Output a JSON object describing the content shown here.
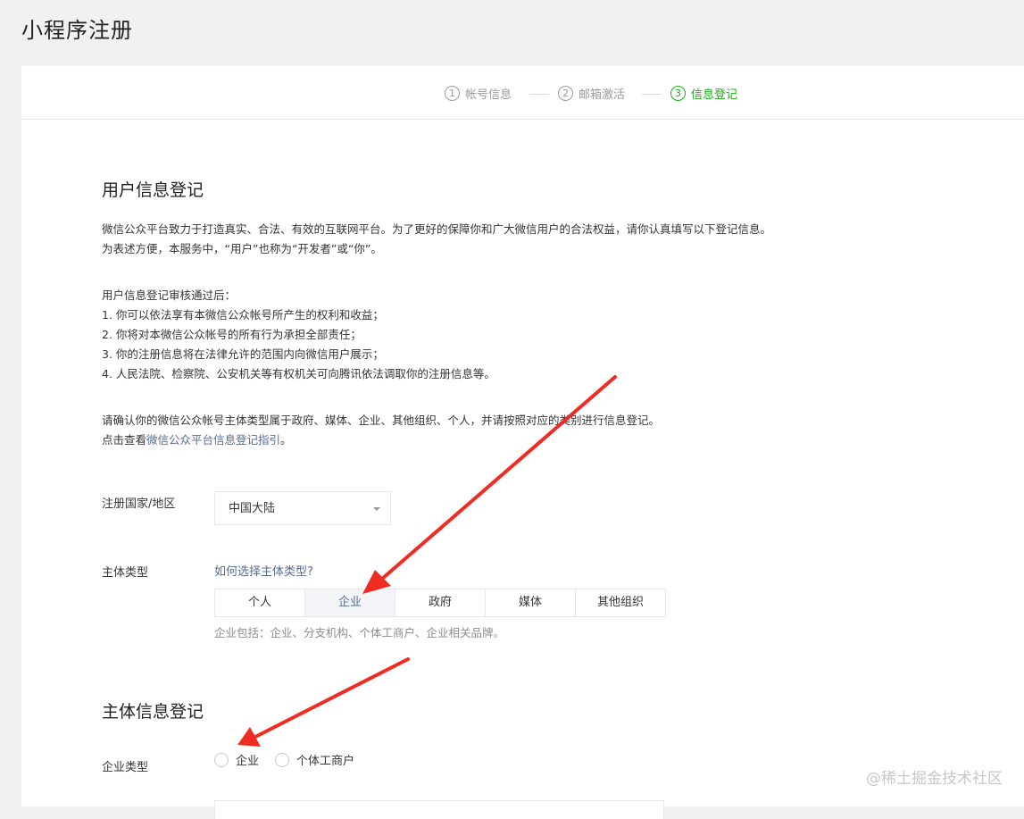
{
  "page": {
    "title": "小程序注册"
  },
  "steps": [
    {
      "num": "1",
      "label": "帐号信息"
    },
    {
      "num": "2",
      "label": "邮箱激活"
    },
    {
      "num": "3",
      "label": "信息登记"
    }
  ],
  "user_section": {
    "heading": "用户信息登记",
    "intro_line1": "微信公众平台致力于打造真实、合法、有效的互联网平台。为了更好的保障你和广大微信用户的合法权益，请你认真填写以下登记信息。",
    "intro_line2": "为表述方便，本服务中，“用户”也称为“开发者”或“你”。",
    "after_title": "用户信息登记审核通过后：",
    "after_items": [
      "1. 你可以依法享有本微信公众帐号所产生的权利和收益；",
      "2. 你将对本微信公众帐号的所有行为承担全部责任；",
      "3. 你的注册信息将在法律允许的范围内向微信用户展示；",
      "4. 人民法院、检察院、公安机关等有权机关可向腾讯依法调取你的注册信息等。"
    ],
    "confirm_text": "请确认你的微信公众帐号主体类型属于政府、媒体、企业、其他组织、个人，并请按照对应的类别进行信息登记。",
    "guide_prefix": "点击查看",
    "guide_link": "微信公众平台信息登记指引",
    "guide_suffix": "。"
  },
  "form": {
    "region_label": "注册国家/地区",
    "region_value": "中国大陆",
    "subject_label": "主体类型",
    "subject_help_link": "如何选择主体类型?",
    "subject_tabs": [
      "个人",
      "企业",
      "政府",
      "媒体",
      "其他组织"
    ],
    "subject_selected": "企业",
    "subject_hint": "企业包括：企业、分支机构、个体工商户、企业相关品牌。"
  },
  "entity_section": {
    "heading": "主体信息登记",
    "company_type_label": "企业类型",
    "company_type_options": [
      "企业",
      "个体工商户"
    ]
  },
  "watermark": "@稀土掘金技术社区",
  "colors": {
    "active_green": "#1aad19",
    "link_blue": "#576b95",
    "arrow_red": "#f02b22"
  }
}
